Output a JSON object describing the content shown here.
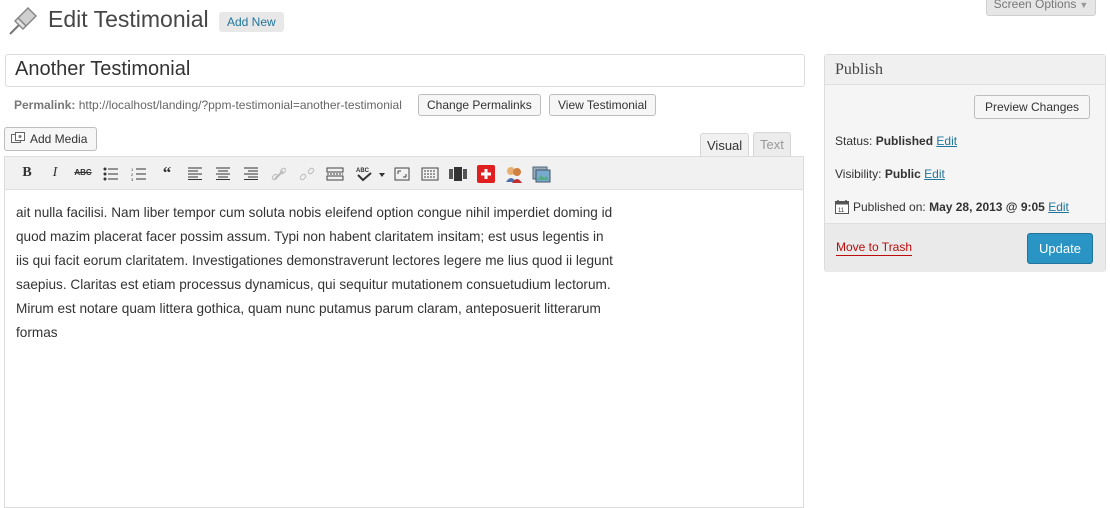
{
  "header": {
    "title": "Edit Testimonial",
    "add_new": "Add New",
    "screen_options": "Screen Options"
  },
  "post": {
    "title": "Another Testimonial",
    "permalink_label": "Permalink:",
    "permalink_url": "http://localhost/landing/?ppm-testimonial=another-testimonial",
    "change_permalinks": "Change Permalinks",
    "view": "View Testimonial"
  },
  "editor": {
    "add_media": "Add Media",
    "tabs": {
      "visual": "Visual",
      "text": "Text"
    },
    "active_tab": "Visual",
    "toolbar_icons": [
      "bold-icon",
      "italic-icon",
      "strikethrough-icon",
      "bullet-list-icon",
      "numbered-list-icon",
      "blockquote-icon",
      "align-left-icon",
      "align-center-icon",
      "align-right-icon",
      "link-icon",
      "unlink-icon",
      "insert-more-icon",
      "spellcheck-icon",
      "fullscreen-icon",
      "kitchen-sink-icon",
      "slider-icon",
      "plus-icon",
      "people-icon",
      "gallery-icon"
    ],
    "content_lines": [
      "ait nulla facilisi. Nam liber tempor cum soluta nobis eleifend option congue nihil imperdiet doming id",
      "quod mazim placerat facer possim assum. Typi non habent claritatem insitam; est usus legentis in",
      "iis qui facit eorum claritatem. Investigationes demonstraverunt lectores legere me lius quod ii legunt",
      "saepius. Claritas est etiam processus dynamicus, qui sequitur mutationem consuetudium lectorum.",
      "Mirum est notare quam littera gothica, quam nunc putamus parum claram, anteposuerit litterarum",
      "formas"
    ]
  },
  "publish": {
    "title": "Publish",
    "preview": "Preview Changes",
    "status_label": "Status:",
    "status_value": "Published",
    "visibility_label": "Visibility:",
    "visibility_value": "Public",
    "published_label": "Published on:",
    "published_value": "May 28, 2013 @ 9:05",
    "edit": "Edit",
    "trash": "Move to Trash",
    "update": "Update"
  },
  "colors": {
    "link": "#21759b",
    "update_button": "#2a95c5",
    "trash": "#bc0b0b"
  }
}
